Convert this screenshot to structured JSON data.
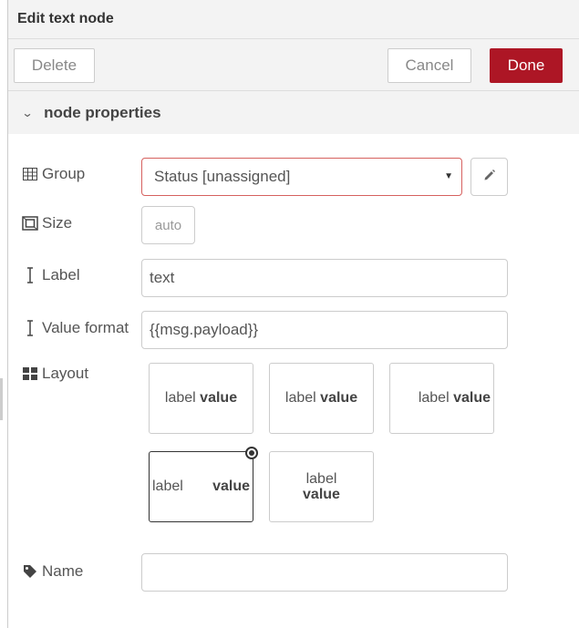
{
  "header": {
    "title": "Edit text node"
  },
  "toolbar": {
    "delete_label": "Delete",
    "cancel_label": "Cancel",
    "done_label": "Done",
    "done_color": "#ad1625"
  },
  "section": {
    "title": "node properties"
  },
  "form": {
    "group": {
      "label": "Group",
      "value": "Status [unassigned]"
    },
    "size": {
      "label": "Size",
      "value": "auto"
    },
    "label_field": {
      "label": "Label",
      "value": "text"
    },
    "value_format": {
      "label": "Value format",
      "value": "{{msg.payload}}"
    },
    "layout": {
      "label": "Layout",
      "options": [
        {
          "label": "label",
          "value": "value",
          "selected": false
        },
        {
          "label": "label",
          "value": "value",
          "selected": false
        },
        {
          "label": "label",
          "value": "value",
          "selected": false
        },
        {
          "label": "label",
          "value": "value",
          "selected": true
        },
        {
          "label": "label",
          "value": "value",
          "selected": false
        }
      ]
    },
    "name": {
      "label": "Name",
      "value": ""
    }
  }
}
